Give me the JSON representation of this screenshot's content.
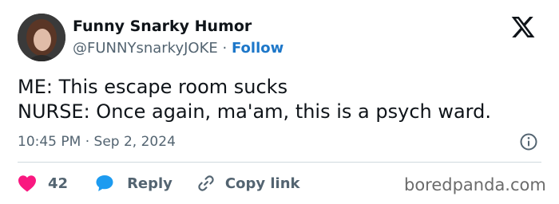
{
  "author": {
    "display_name": "Funny Snarky Humor",
    "handle": "@FUNNYsnarkyJOKE",
    "separator": "·",
    "follow_label": "Follow"
  },
  "tweet": {
    "lines": [
      "ME: This escape room sucks",
      "NURSE: Once again, ma'am, this is a psych ward."
    ],
    "time": "10:45 PM",
    "date_separator": "·",
    "date": "Sep 2, 2024"
  },
  "actions": {
    "like_count": "42",
    "reply_label": "Reply",
    "copy_label": "Copy link"
  },
  "watermark": "boredpanda.com",
  "icons": {
    "platform": "x-logo-icon",
    "info": "info-icon",
    "like": "heart-icon",
    "reply": "speech-bubble-icon",
    "copy": "link-icon"
  },
  "colors": {
    "text": "#0f1419",
    "secondary": "#536471",
    "follow": "#1d77c9",
    "heart": "#f91880",
    "reply_bubble": "#1d9bf0",
    "divider": "#cfd9de"
  }
}
